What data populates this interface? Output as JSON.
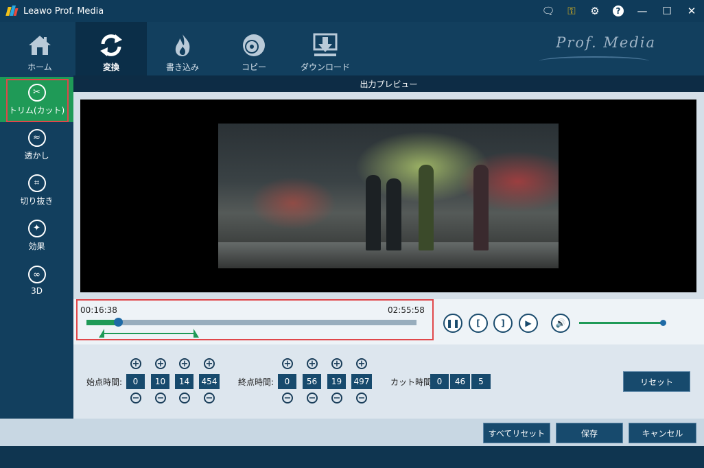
{
  "titlebar": {
    "app_name": "Leawo Prof. Media",
    "icons": [
      "chat-icon",
      "key-icon",
      "gear-icon",
      "help-icon",
      "minimize-icon",
      "maximize-icon",
      "close-icon"
    ]
  },
  "topnav": {
    "items": [
      {
        "label": "ホーム",
        "icon": "home-icon"
      },
      {
        "label": "変換",
        "icon": "convert-icon",
        "active": true
      },
      {
        "label": "書き込み",
        "icon": "burn-icon"
      },
      {
        "label": "コピー",
        "icon": "copy-icon"
      },
      {
        "label": "ダウンロード",
        "icon": "download-icon"
      }
    ],
    "brand": "Prof. Media"
  },
  "sidebar": {
    "items": [
      {
        "label": "トリム(カット)",
        "icon": "scissors-icon",
        "active": true
      },
      {
        "label": "透かし",
        "icon": "watermark-icon"
      },
      {
        "label": "切り抜き",
        "icon": "crop-icon"
      },
      {
        "label": "効果",
        "icon": "effect-icon"
      },
      {
        "label": "3D",
        "icon": "3d-glasses-icon"
      }
    ]
  },
  "preview": {
    "title": "出力プレビュー"
  },
  "timeline": {
    "current_time": "00:16:38",
    "duration": "02:55:58",
    "progress_fraction": 0.095,
    "range_start_fraction": 0.06,
    "range_end_fraction": 0.32
  },
  "playback": {
    "buttons": [
      "pause-icon",
      "set-start-icon",
      "set-end-icon",
      "play-segment-icon",
      "volume-icon"
    ],
    "volume_fraction": 0.96
  },
  "trim": {
    "start_label": "始点時間:",
    "start_values": [
      "0",
      "10",
      "14",
      "454"
    ],
    "end_label": "終点時間:",
    "end_values": [
      "0",
      "56",
      "19",
      "497"
    ],
    "cut_label": "カット時間:",
    "cut_values": [
      "0",
      "46",
      "5"
    ],
    "plus_symbol": "+",
    "minus_symbol": "−",
    "reset_label": "リセット"
  },
  "footer": {
    "reset_all_label": "すべてリセット",
    "save_label": "保存",
    "cancel_label": "キャンセル"
  },
  "colors": {
    "accent_green": "#1f9a57",
    "navy": "#123f5e",
    "highlight_red": "#e0474a"
  }
}
